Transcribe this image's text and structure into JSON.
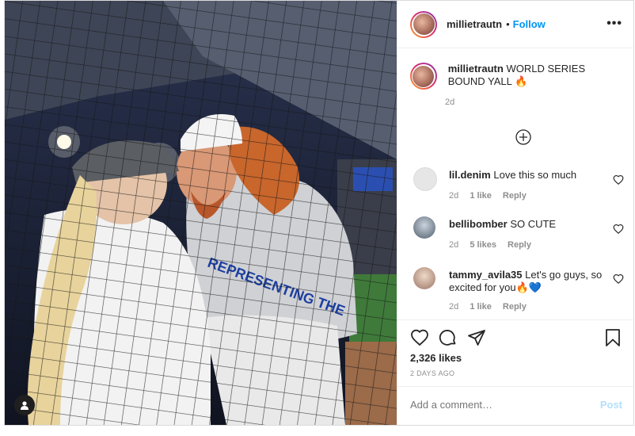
{
  "header": {
    "username": "millietrautn",
    "separator": "•",
    "follow_label": "Follow",
    "more_icon": "•••"
  },
  "caption": {
    "username": "millietrautn",
    "text": "WORLD SERIES BOUND YALL 🔥",
    "time": "2d"
  },
  "comments": [
    {
      "username": "lil.denim",
      "text": "Love this so much",
      "time": "2d",
      "likes": "1 like",
      "reply": "Reply"
    },
    {
      "username": "bellibomber",
      "text": "SO CUTE",
      "time": "2d",
      "likes": "5 likes",
      "reply": "Reply"
    },
    {
      "username": "tammy_avila35",
      "text": "Let's go guys, so excited for you🔥💙",
      "time": "2d",
      "likes": "1 like",
      "reply": "Reply"
    }
  ],
  "actions": {
    "likes": "2,326 likes",
    "age": "2 DAYS AGO"
  },
  "add_comment": {
    "placeholder": "Add a comment…",
    "post_label": "Post"
  },
  "icons": {
    "like": "heart-icon",
    "comment": "comment-icon",
    "share": "paper-plane-icon",
    "save": "bookmark-icon",
    "tag": "user-tag-icon",
    "load_more": "plus-circle-icon"
  },
  "colors": {
    "link": "#0095f6",
    "post_disabled": "#b2dffc",
    "muted": "#8e8e8e"
  }
}
